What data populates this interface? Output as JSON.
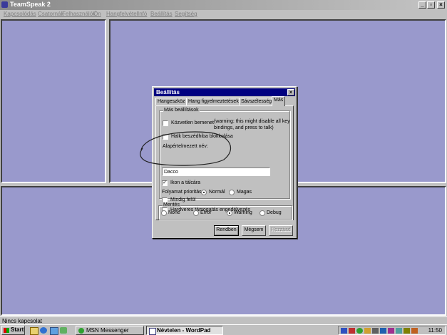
{
  "window": {
    "title": "TeamSpeak 2",
    "min": "_",
    "max": "▫",
    "close": "×"
  },
  "menu": [
    "Kapcsolódás",
    "Csatornák",
    "Felhasználók",
    "Ön",
    "Hangfelvétel",
    "Infó",
    "Beállítás",
    "Segítség"
  ],
  "status": {
    "text": "Nincs kapcsolat"
  },
  "dialog": {
    "title": "Beállítás",
    "close": "×",
    "tabs": [
      "Hangeszköz",
      "Hang figyelmeztetések",
      "Sávszélesség",
      "Más"
    ],
    "group_other": "Más beállítások",
    "direct_input": {
      "label": "Közvetlen bemenet",
      "checked": false
    },
    "direct_warning": [
      "(warning: this might disable all key",
      "bindings, and press to talk)"
    ],
    "block_chat": {
      "label": "Halk beszédhiba blokkolása",
      "checked": false
    },
    "default_name_label": "Alapértelmezett név:",
    "default_name_value": "Dacco",
    "tray_icon": {
      "label": "Ikon a tálcára",
      "checked": true,
      "mark": "✓"
    },
    "priority_label": "Folyamat prioritás:",
    "priority_normal": "Normál",
    "priority_high": "Magas",
    "always_on_top": {
      "label": "Mindig felül",
      "checked": false
    },
    "hw_support": {
      "label": "Hardveres támogatás engedélyezés",
      "checked": false
    },
    "group_save": "Mentés",
    "log_levels": [
      "None",
      "Error",
      "Warning",
      "Debug"
    ],
    "log_selected": "Warning",
    "buttons": {
      "ok": "Rendben",
      "cancel": "Mégsem",
      "apply": "Hozzáad"
    }
  },
  "taskbar": {
    "start": "Start",
    "items": [
      "MSN Messenger",
      "Névtelen - WordPad"
    ],
    "active_item": "Névtelen - WordPad",
    "clock": "11:50"
  },
  "colors": {
    "workspace": "#9999cc",
    "dialog_title": "#000080",
    "chrome": "#c0c0c0"
  }
}
